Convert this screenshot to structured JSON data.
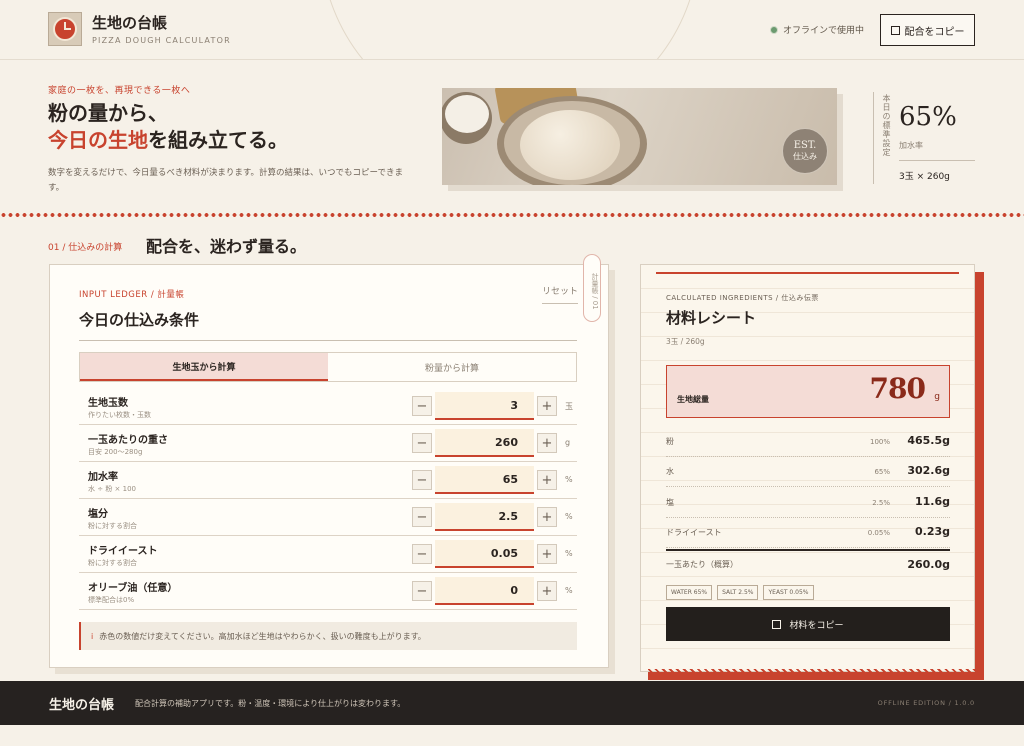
{
  "header": {
    "app_title": "生地の台帳",
    "app_subtitle": "PIZZA DOUGH CALCULATOR",
    "offline_status": "オフラインで使用中",
    "copy_button": "配合をコピー"
  },
  "hero": {
    "eyebrow": "家庭の一枚を、再現できる一枚へ",
    "headline_line1": "粉の量から、",
    "headline_red": "今日の生地",
    "headline_rest": "を組み立てる。",
    "description": "数字を変えるだけで、今日量るべき材料が決まります。計算の結果は、いつでもコピーできます。",
    "image_badge_top": "EST.",
    "image_badge_bottom": "仕込み",
    "standard": {
      "vertical_label": "本日の標準設定",
      "value": "65%",
      "label": "加水率",
      "quantity": "3玉 × 260g"
    }
  },
  "section": {
    "number": "01 / 仕込みの計算",
    "title": "配合を、迷わず量る。"
  },
  "ledger": {
    "eyebrow_en": "INPUT LEDGER / ",
    "eyebrow_ja": "計量帳",
    "title": "今日の仕込み条件",
    "reset": "リセット",
    "side_tab": "計量帳 / 01",
    "tabs": [
      "生地玉から計算",
      "粉量から計算"
    ],
    "rows": [
      {
        "label": "生地玉数",
        "hint": "作りたい枚数・玉数",
        "value": "3",
        "unit": "玉"
      },
      {
        "label": "一玉あたりの重さ",
        "hint": "目安 200〜280g",
        "value": "260",
        "unit": "g"
      },
      {
        "label": "加水率",
        "hint": "水 ÷ 粉 × 100",
        "value": "65",
        "unit": "%"
      },
      {
        "label": "塩分",
        "hint": "粉に対する割合",
        "value": "2.5",
        "unit": "%"
      },
      {
        "label": "ドライイースト",
        "hint": "粉に対する割合",
        "value": "0.05",
        "unit": "%"
      },
      {
        "label": "オリーブ油（任意）",
        "hint": "標準配合は0%",
        "value": "0",
        "unit": "%"
      }
    ],
    "note_icon": "i",
    "note": "赤色の数値だけ変えてください。高加水ほど生地はやわらかく、扱いの難度も上がります。"
  },
  "recipe": {
    "eyebrow": "CALCULATED INGREDIENTS / 仕込み伝票",
    "title": "材料レシート",
    "subtitle": "3玉 / 260g",
    "total_label": "生地総量",
    "total_value": "780",
    "total_unit": "g",
    "ingredients": [
      {
        "name": "粉",
        "pct": "100%",
        "value": "465.5g"
      },
      {
        "name": "水",
        "pct": "65%",
        "value": "302.6g"
      },
      {
        "name": "塩",
        "pct": "2.5%",
        "value": "11.6g"
      },
      {
        "name": "ドライイースト",
        "pct": "0.05%",
        "value": "0.23g"
      }
    ],
    "per_ball_label": "一玉あたり（概算）",
    "per_ball_value": "260.0g",
    "badges": [
      "WATER 65%",
      "SALT 2.5%",
      "YEAST 0.05%"
    ],
    "copy_button": "材料をコピー"
  },
  "footer": {
    "title": "生地の台帳",
    "text": "配合計算の補助アプリです。粉・温度・環境により仕上がりは変わります。",
    "edition": "OFFLINE EDITION / 1.0.0"
  }
}
